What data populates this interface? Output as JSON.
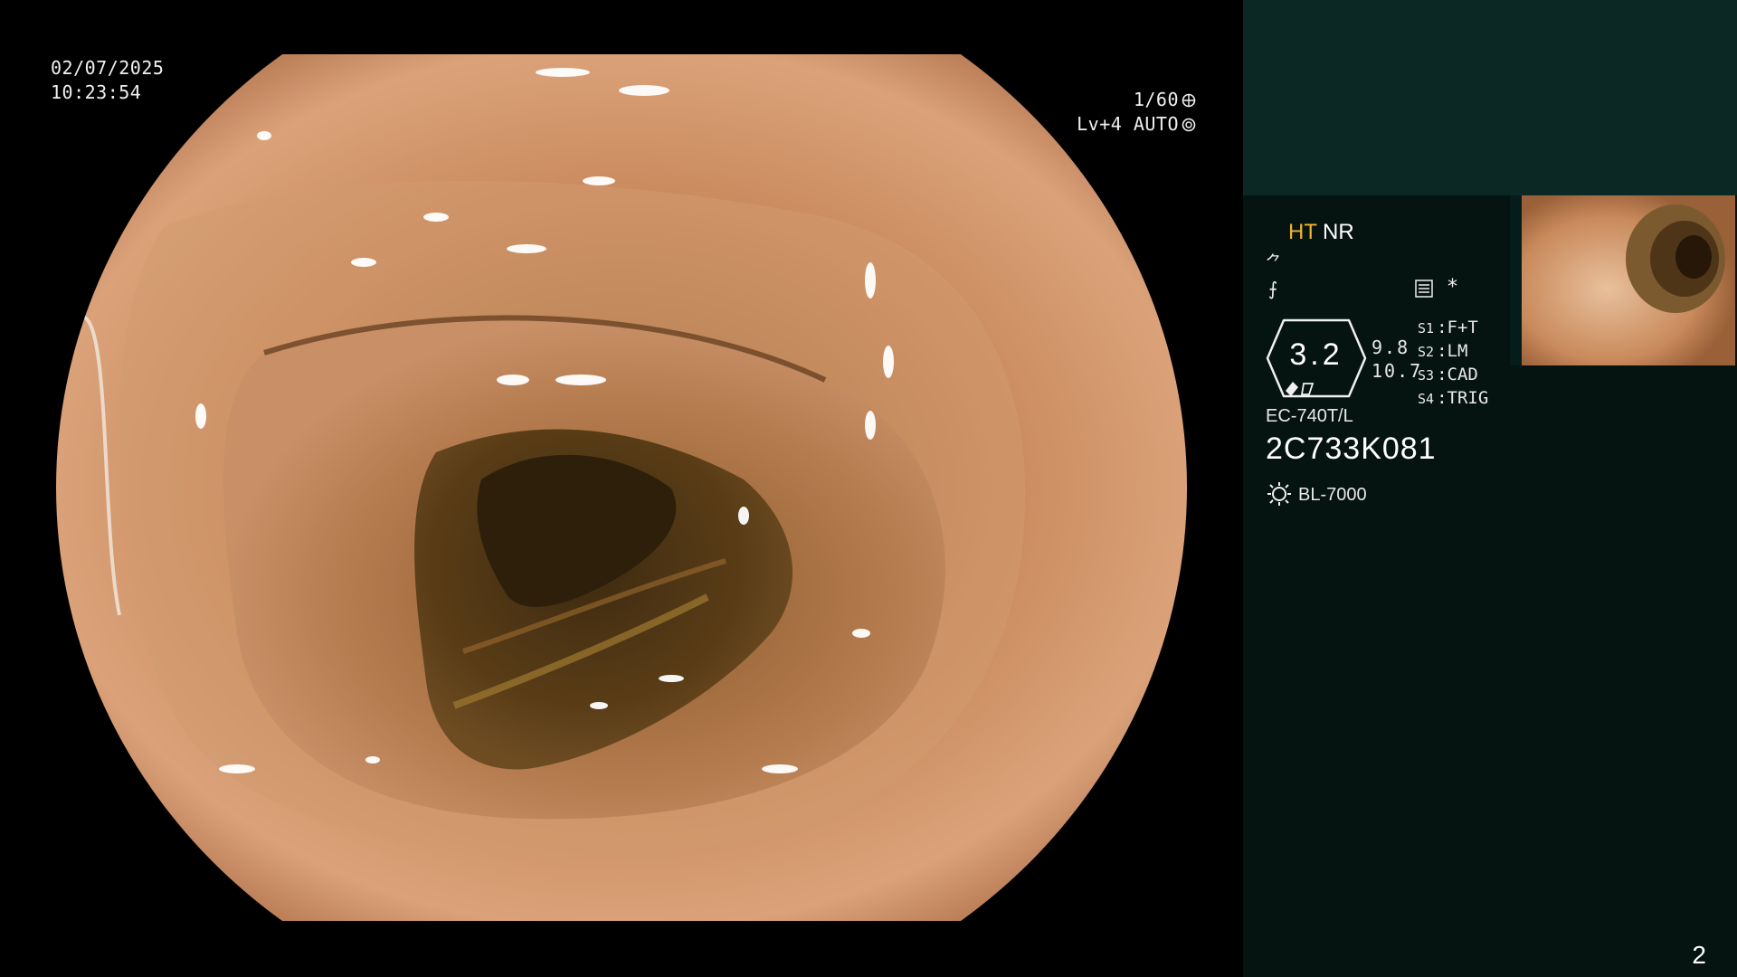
{
  "overlay": {
    "date": "02/07/2025",
    "time": "10:23:54",
    "shutter": "1/60",
    "level": "Lv+4 AUTO"
  },
  "settings": {
    "ht": "HT",
    "nr": "NR",
    "enhance_icon": "enhance-icon",
    "structure_icon": "structure-icon",
    "asterisk": "*",
    "gauge_value": "3.2",
    "aux_values": [
      "9.8",
      "10.7"
    ],
    "switches": [
      {
        "id": "S1",
        "value": "F+T"
      },
      {
        "id": "S2",
        "value": "LM"
      },
      {
        "id": "S3",
        "value": "CAD"
      },
      {
        "id": "S4",
        "value": "TRIG"
      }
    ],
    "scope_model": "EC-740T/L",
    "serial": "2C733K081",
    "light_source": "BL-7000"
  },
  "thumbnail": {
    "label": "colon-lumen-thumbnail"
  },
  "page_number": "2",
  "colors": {
    "panel_bg": "#051311",
    "panel_top": "#0b2824",
    "ht_color": "#f2b32e",
    "tissue": "#c98a5c"
  }
}
